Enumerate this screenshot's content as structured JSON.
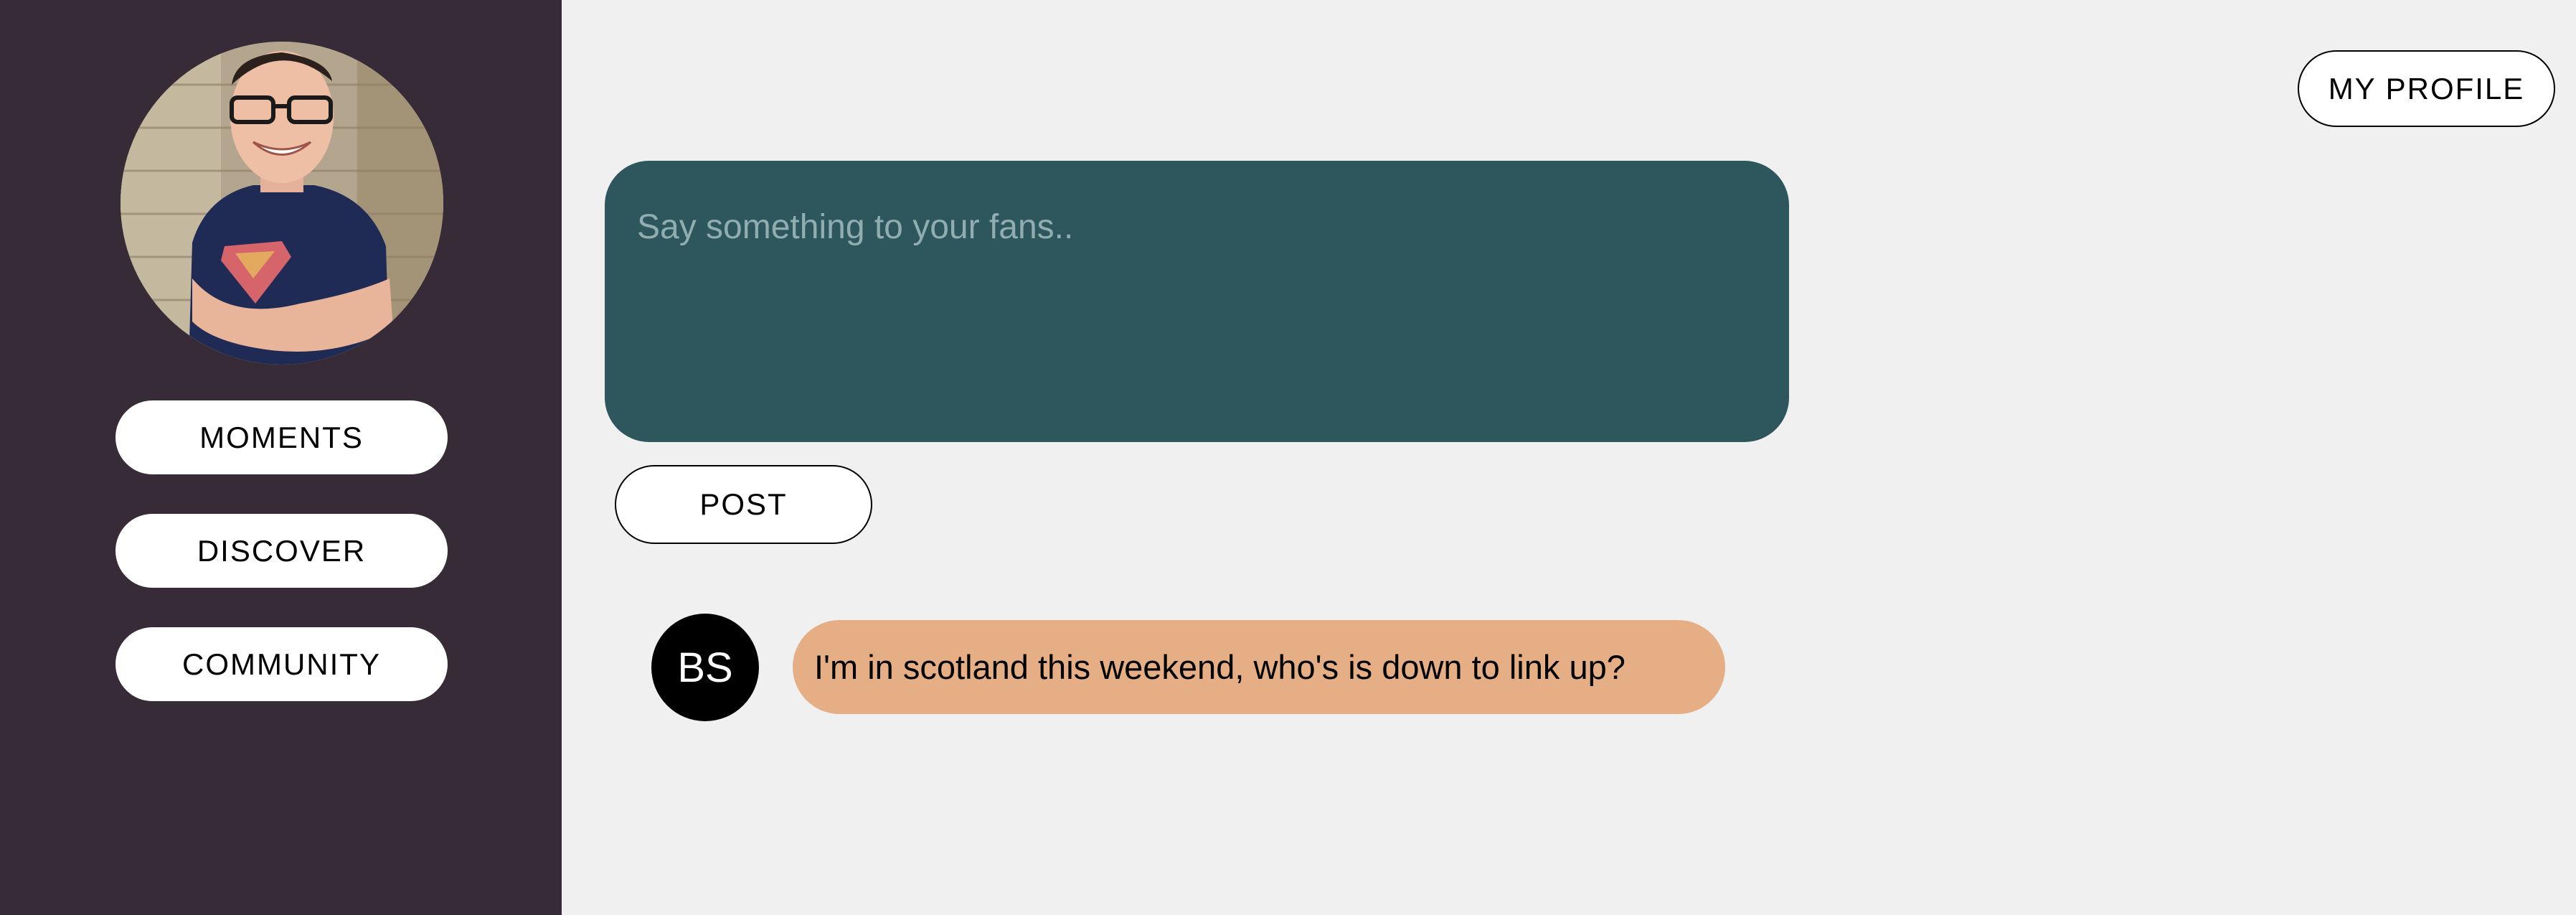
{
  "sidebar": {
    "avatar_alt": "profile photo",
    "nav": [
      {
        "label": "MOMENTS"
      },
      {
        "label": "DISCOVER"
      },
      {
        "label": "COMMUNITY"
      }
    ]
  },
  "header": {
    "profile_label": "MY PROFILE"
  },
  "composer": {
    "placeholder": "Say something to your fans..",
    "value": "",
    "post_label": "POST"
  },
  "feed": {
    "posts": [
      {
        "author_initials": "BS",
        "text": "I'm in scotland this weekend, who's is down to link up?"
      }
    ]
  },
  "colors": {
    "sidebar_bg": "#372b37",
    "page_bg": "#f0f0f0",
    "composer_bg": "#2e565d",
    "message_bubble": "#e6ae84"
  }
}
